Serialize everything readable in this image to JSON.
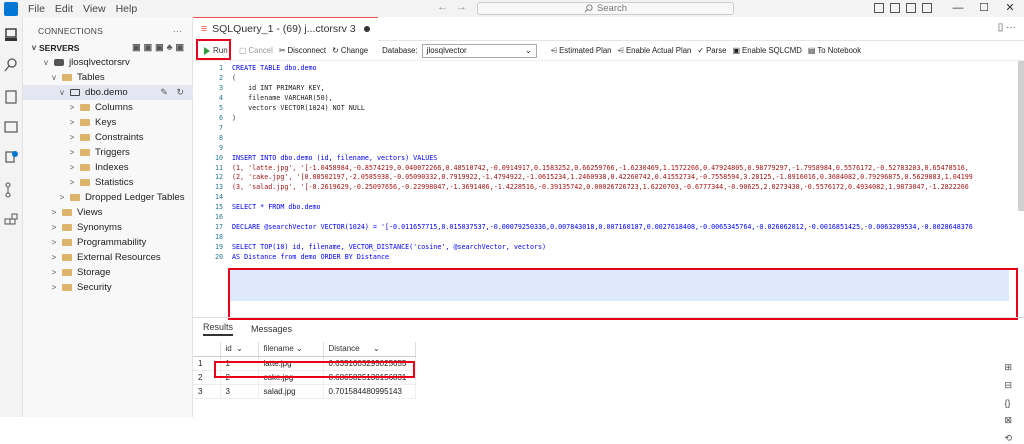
{
  "titlebar": {
    "menu": [
      "File",
      "Edit",
      "View",
      "Help"
    ],
    "search_placeholder": "Search"
  },
  "sidebar": {
    "title": "CONNECTIONS",
    "servers_label": "SERVERS",
    "items": [
      {
        "label": "jlosqlvectorsrv",
        "depth": 1,
        "chev": "v"
      },
      {
        "label": "Tables",
        "depth": 2,
        "chev": "v"
      },
      {
        "label": "dbo.demo",
        "depth": 3,
        "chev": "v",
        "sel": true
      },
      {
        "label": "Columns",
        "depth": 4,
        "chev": ">"
      },
      {
        "label": "Keys",
        "depth": 4,
        "chev": ">"
      },
      {
        "label": "Constraints",
        "depth": 4,
        "chev": ">"
      },
      {
        "label": "Triggers",
        "depth": 4,
        "chev": ">"
      },
      {
        "label": "Indexes",
        "depth": 4,
        "chev": ">"
      },
      {
        "label": "Statistics",
        "depth": 4,
        "chev": ">"
      },
      {
        "label": "Dropped Ledger Tables",
        "depth": 3,
        "chev": ">"
      },
      {
        "label": "Views",
        "depth": 2,
        "chev": ">"
      },
      {
        "label": "Synonyms",
        "depth": 2,
        "chev": ">"
      },
      {
        "label": "Programmability",
        "depth": 2,
        "chev": ">"
      },
      {
        "label": "External Resources",
        "depth": 2,
        "chev": ">"
      },
      {
        "label": "Storage",
        "depth": 2,
        "chev": ">"
      },
      {
        "label": "Security",
        "depth": 2,
        "chev": ">"
      }
    ]
  },
  "tab": {
    "label": "SQLQuery_1 - (69) j...ctorsrv 3"
  },
  "toolbar": {
    "run": "Run",
    "cancel": "Cancel",
    "disconnect": "Disconnect",
    "change": "Change",
    "database_label": "Database:",
    "database": "jlosqlvector",
    "estimated": "Estimated Plan",
    "actual": "Enable Actual Plan",
    "parse": "Parse",
    "sqlcmd": "Enable SQLCMD",
    "notebook": "To Notebook"
  },
  "code": {
    "lines": [
      "CREATE TABLE dbo.demo",
      "(",
      "    id INT PRIMARY KEY,",
      "    filename VARCHAR(50),",
      "    vectors VECTOR(1024) NOT NULL",
      ")",
      "",
      "",
      "",
      "INSERT INTO dbo.demo (id, filename, vectors) VALUES",
      "(1, 'latte.jpg', '[-1.0458984,-0.8574219,0.040072266,0.48510742,-0.0914917,0.1583252,0.66259766,-1.6230469,1.1572266,0.47924805,0.98779297,-1.7958984,0.5576172,-0.52783203,0.65478516,",
      "(2, 'cake.jpg', '[0.08502197,-2.0585938,-0.05090332,0.7919922,-1.4794922,-1.0615234,1.2460938,0.42260742,0.41552734,-0.7558594,3.28125,-1.8916016,0.3684082,0.79296875,0.5629883,1.04199",
      "(3, 'salad.jpg', '[-0.2619629,-0.25097656,-0.22998047,-1.3691406,-1.4228516,-0.39135742,0.00026726723,1.6220703,-0.6777344,-0.90625,2.0273438,-0.5576172,0.4934082,1.9873047,-1.2822266",
      "",
      "SELECT * FROM dbo.demo",
      "",
      "DECLARE @searchVector VECTOR(1024) = '[-0.011657715,0.015037537,-0.00079250336,0.007843018,0.007160187,0.0027618408,-0.0065345764,-0.026062012,-0.0016851425,-0.0063209534,-0.0028648376",
      "",
      "SELECT TOP(10) id, filename, VECTOR_DISTANCE('cosine', @searchVector, vectors)",
      "AS Distance from demo ORDER BY Distance"
    ]
  },
  "results": {
    "tab_results": "Results",
    "tab_messages": "Messages",
    "columns": [
      "id",
      "filename",
      "Distance"
    ],
    "rows": [
      [
        "1",
        "1",
        "latte.jpg",
        "0.6351003295025655"
      ],
      [
        "2",
        "2",
        "cake.jpg",
        "0.6865825130156831"
      ],
      [
        "3",
        "3",
        "salad.jpg",
        "0.701584480995143"
      ]
    ]
  }
}
